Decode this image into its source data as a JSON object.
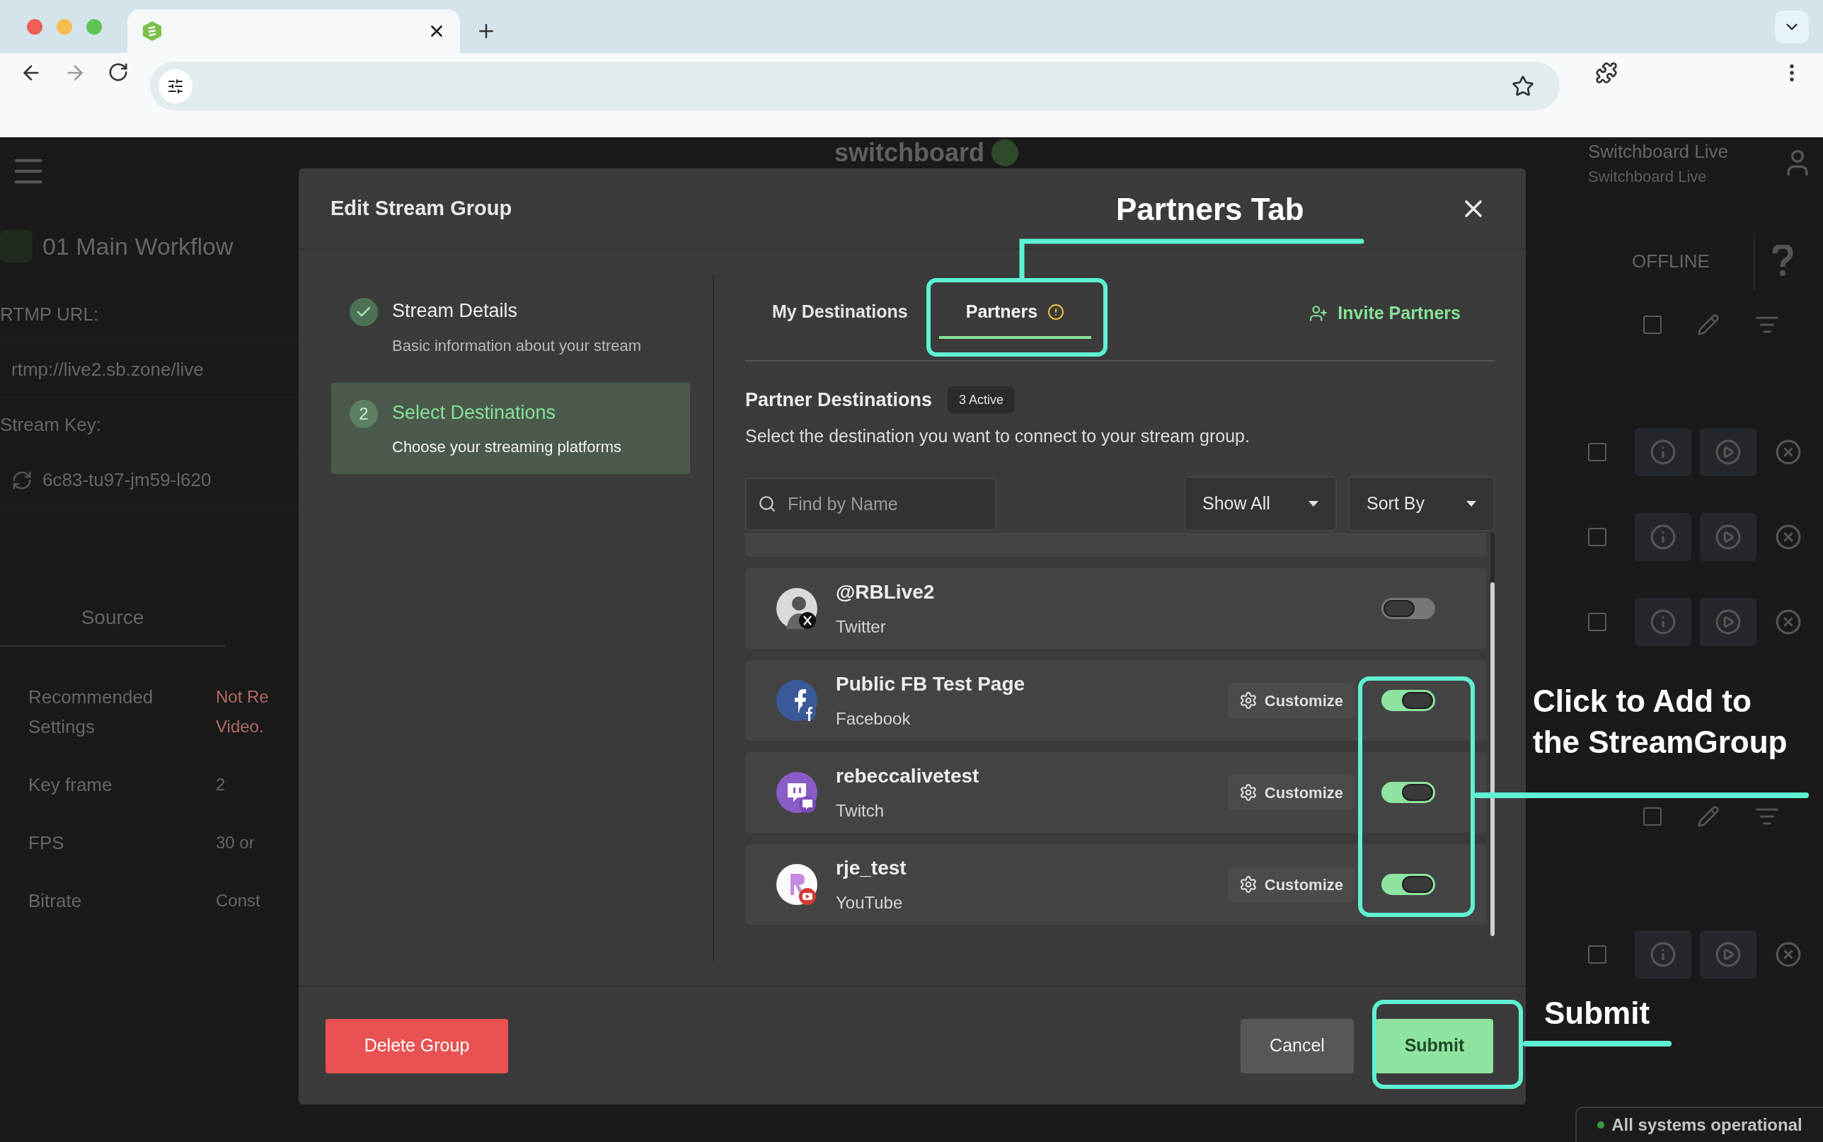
{
  "background_app": {
    "logo": "switchboard",
    "account": {
      "name": "Switchboard Live",
      "subtitle": "Switchboard Live"
    },
    "status": "OFFLINE",
    "workflow": "01 Main Workflow",
    "fields": [
      {
        "label": "RTMP URL:",
        "value": "rtmp://live2.sb.zone/live"
      },
      {
        "label": "Stream Key:",
        "value": "6c83-tu97-jm59-l620"
      }
    ],
    "tab": "Source",
    "settings": [
      {
        "label": "Recommended Settings",
        "value_lines": [
          "Not Re",
          "Video."
        ],
        "warning": true
      },
      {
        "label": "Key frame",
        "value_lines": [
          "2"
        ],
        "warning": false
      },
      {
        "label": "FPS",
        "value_lines": [
          "30 or"
        ],
        "warning": false
      },
      {
        "label": "Bitrate",
        "value_lines": [
          "Const"
        ],
        "warning": false
      }
    ],
    "toolbar_rows": [
      {
        "checked": false
      },
      {
        "checked": false
      }
    ],
    "stream_rows": [
      {
        "checked": false
      },
      {
        "checked": false
      },
      {
        "checked": false
      },
      {
        "checked": false
      }
    ],
    "system_status": "All systems operational"
  },
  "dialog": {
    "title": "Edit Stream Group",
    "steps": [
      {
        "kind": "done",
        "title": "Stream Details",
        "description": "Basic information about your stream",
        "selected": false
      },
      {
        "kind": "current",
        "number": "2",
        "title": "Select Destinations",
        "description": "Choose your streaming platforms",
        "selected": true
      }
    ],
    "tabs": [
      {
        "label": "My Destinations",
        "selected": false,
        "warning": false
      },
      {
        "label": "Partners",
        "selected": true,
        "warning": true
      }
    ],
    "invite_link": "Invite Partners",
    "section": {
      "title": "Partner Destinations",
      "badge": "3 Active",
      "description": "Select the destination you want to connect to your stream group."
    },
    "search": {
      "placeholder": "Find by Name"
    },
    "filters": [
      "Show All",
      "Sort By"
    ],
    "destinations": [
      {
        "name": "@RBLive2",
        "platform": "Twitter",
        "kind": "x",
        "on": false
      },
      {
        "name": "Public FB Test Page",
        "platform": "Facebook",
        "kind": "facebook",
        "action": "Customize",
        "on": true
      },
      {
        "name": "rebeccalivetest",
        "platform": "Twitch",
        "kind": "twitch",
        "action": "Customize",
        "on": true
      },
      {
        "name": "rje_test",
        "platform": "YouTube",
        "kind": "youtube",
        "action": "Customize",
        "on": true
      }
    ],
    "footer": {
      "delete": "Delete Group",
      "cancel": "Cancel",
      "submit": "Submit"
    }
  },
  "annotations": [
    {
      "text": "Partners Tab"
    },
    {
      "text": "Click to Add to the StreamGroup"
    },
    {
      "text": "Submit"
    }
  ]
}
